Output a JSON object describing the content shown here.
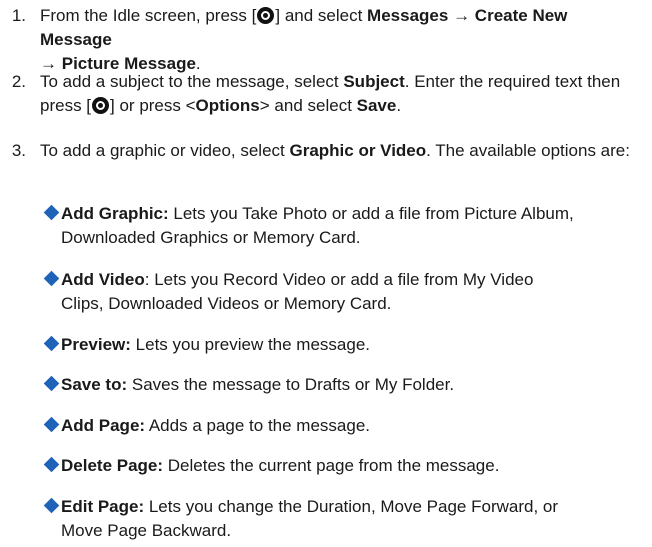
{
  "steps": [
    {
      "num": "1.",
      "p1": "From the Idle screen, press [",
      "p2": "] and select ",
      "b1": "Messages",
      "arrow1": "→",
      "b2": "Create New Message",
      "arrow2": "→",
      "b3": "Picture Message",
      "end": "."
    },
    {
      "num": "2.",
      "p1": "To add a subject to the message, select ",
      "b1": "Subject",
      "p2": ". Enter the required text then press [",
      "p3": "] or press <",
      "b2": "Options",
      "p4": "> and select ",
      "b3": "Save",
      "end": "."
    },
    {
      "num": "3.",
      "p1": "To add a graphic or video, select ",
      "b1": "Graphic or Video",
      "p2": ". The available options are:"
    }
  ],
  "options": [
    {
      "label": "Add Graphic:",
      "desc": " Lets you Take Photo or add a file from Picture Album,",
      "cont": "Downloaded Graphics or Memory Card."
    },
    {
      "label": "Add Video",
      "desc": ": Lets you Record Video or add a file from My Video",
      "cont": "Clips, Downloaded Videos or Memory Card."
    },
    {
      "label": "Preview:",
      "desc": " Lets you preview the message."
    },
    {
      "label": "Save to:",
      "desc": " Saves the message to Drafts or My Folder."
    },
    {
      "label": "Add Page:",
      "desc": " Adds a page to the message."
    },
    {
      "label": "Delete Page:",
      "desc": " Deletes the current page from the message."
    },
    {
      "label": "Edit Page:",
      "desc": " Lets you change the Duration, Move Page Forward, or",
      "cont": "Move Page Backward."
    }
  ],
  "colors": {
    "bullet": "#1f63b8",
    "text": "#1a1a1a"
  },
  "icons": {
    "ok_button": "center-select-key-icon",
    "bullet": "diamond-bullet-icon"
  }
}
